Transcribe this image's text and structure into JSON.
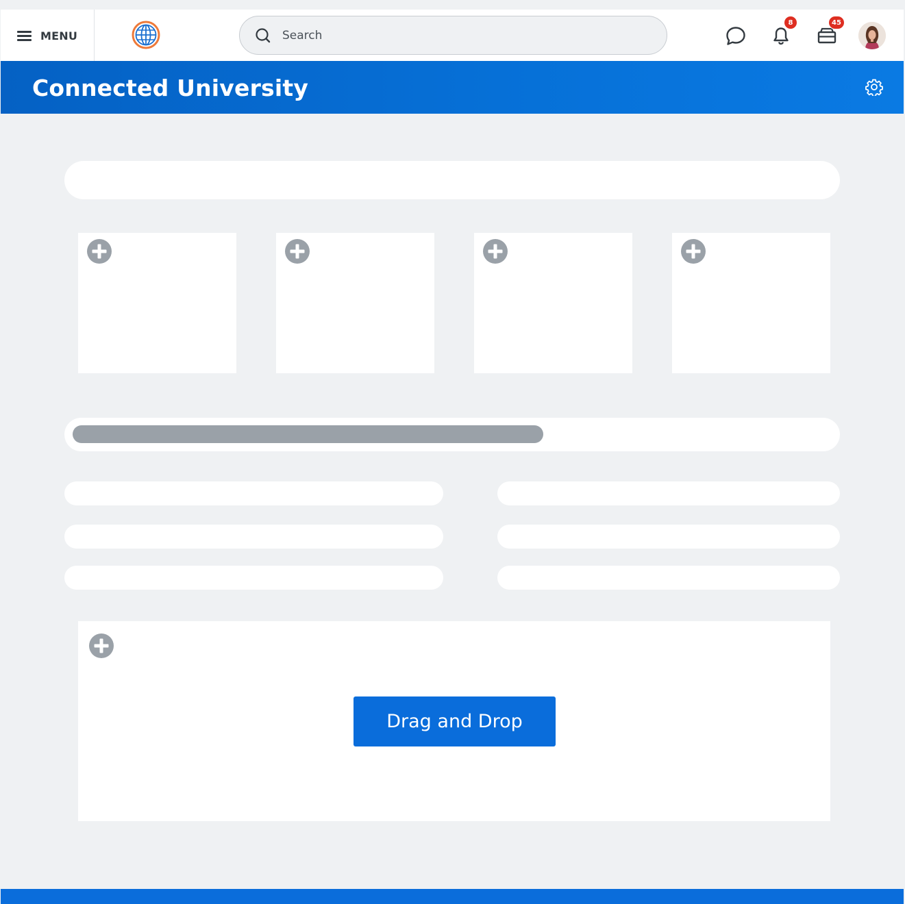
{
  "topbar": {
    "menu_label": "MENU",
    "search": {
      "placeholder": "Search",
      "value": ""
    },
    "notifications": {
      "count": "8"
    },
    "inbox": {
      "count": "45"
    }
  },
  "header": {
    "title": "Connected University"
  },
  "progress": {
    "fill_percent": 62
  },
  "drop_zone": {
    "button_label": "Drag and Drop"
  },
  "colors": {
    "primary": "#0a6ddb",
    "header_start": "#0561c4",
    "badge": "#de2e21",
    "background": "#eff1f3",
    "placeholder_gray": "#9aa1a8"
  },
  "icons": [
    "hamburger-icon",
    "globe-logo-icon",
    "search-icon",
    "chat-icon",
    "bell-icon",
    "inbox-icon",
    "gear-icon",
    "plus-circle-icon"
  ]
}
